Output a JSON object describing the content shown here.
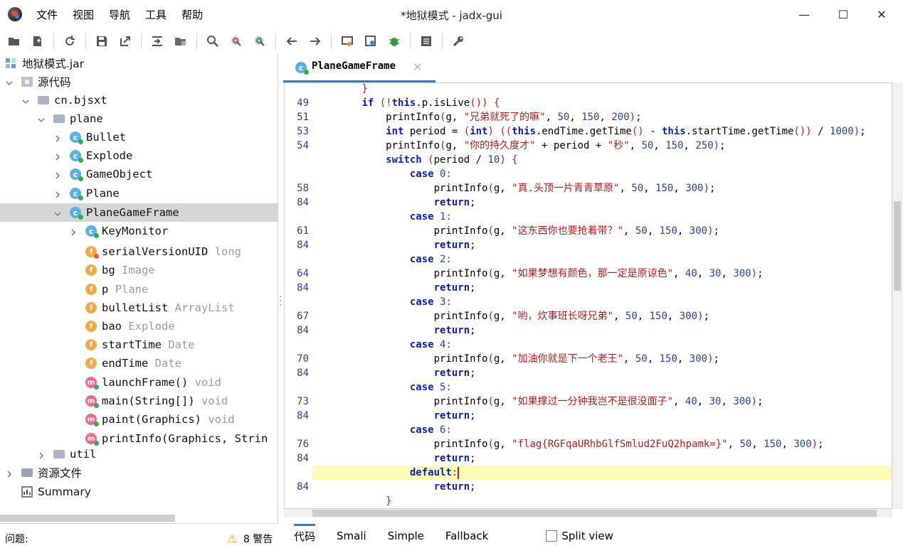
{
  "window": {
    "title": "*地狱模式 - jadx-gui",
    "minimize": "—",
    "maximize": "☐",
    "close": "✕"
  },
  "menu": [
    "文件",
    "视图",
    "导航",
    "工具",
    "帮助"
  ],
  "toolbar": [
    "open-file",
    "add-files",
    "sync",
    "save-all",
    "export",
    "expand",
    "sync-tree",
    "search",
    "find-class",
    "find-usage",
    "back",
    "forward",
    "decompile-settings",
    "deobfuscation",
    "debug",
    "log",
    "preferences"
  ],
  "tree": {
    "root": "地狱模式.jar",
    "sources": "源代码",
    "package": "cn.bjsxt",
    "subpackage": "plane",
    "classes": [
      "Bullet",
      "Explode",
      "GameObject",
      "Plane",
      "PlaneGameFrame"
    ],
    "inner_class": "KeyMonitor",
    "fields": [
      {
        "name": "serialVersionUID",
        "type": "long"
      },
      {
        "name": "bg",
        "type": "Image"
      },
      {
        "name": "p",
        "type": "Plane"
      },
      {
        "name": "bulletList",
        "type": "ArrayList"
      },
      {
        "name": "bao",
        "type": "Explode"
      },
      {
        "name": "startTime",
        "type": "Date"
      },
      {
        "name": "endTime",
        "type": "Date"
      }
    ],
    "methods": [
      {
        "name": "launchFrame()",
        "type": "void"
      },
      {
        "name": "main(String[])",
        "type": "void"
      },
      {
        "name": "paint(Graphics)",
        "type": "void"
      },
      {
        "name": "printInfo(Graphics, Strin",
        "type": ""
      }
    ],
    "util": "util",
    "resources": "资源文件",
    "summary": "Summary"
  },
  "status": {
    "problems_label": "问题:",
    "warnings": "8 警告"
  },
  "tab": {
    "label": "PlaneGameFrame",
    "close": "×"
  },
  "bottom_tabs": {
    "code": "代码",
    "smali": "Smali",
    "simple": "Simple",
    "fallback": "Fallback",
    "split": "Split view"
  },
  "code_lines": [
    {
      "ln": "",
      "text": "        }"
    },
    {
      "ln": "49",
      "text": "        if (!this.p.isLive()) {"
    },
    {
      "ln": "51",
      "text": "            printInfo(g, \"兄弟就死了的嘛\", 50, 150, 200);"
    },
    {
      "ln": "53",
      "text": "            int period = (int) ((this.endTime.getTime() - this.startTime.getTime()) / 1000);"
    },
    {
      "ln": "54",
      "text": "            printInfo(g, \"你的持久度才\" + period + \"秒\", 50, 150, 250);"
    },
    {
      "ln": "",
      "text": "            switch (period / 10) {"
    },
    {
      "ln": "",
      "text": "                case 0:"
    },
    {
      "ln": "58",
      "text": "                    printInfo(g, \"真.头顶一片青青草原\", 50, 150, 300);"
    },
    {
      "ln": "84",
      "text": "                    return;"
    },
    {
      "ln": "",
      "text": "                case 1:"
    },
    {
      "ln": "61",
      "text": "                    printInfo(g, \"这东西你也要抢着带？\", 50, 150, 300);"
    },
    {
      "ln": "84",
      "text": "                    return;"
    },
    {
      "ln": "",
      "text": "                case 2:"
    },
    {
      "ln": "64",
      "text": "                    printInfo(g, \"如果梦想有颜色，那一定是原谅色\", 40, 30, 300);"
    },
    {
      "ln": "84",
      "text": "                    return;"
    },
    {
      "ln": "",
      "text": "                case 3:"
    },
    {
      "ln": "67",
      "text": "                    printInfo(g, \"哟，炊事班长呀兄弟\", 50, 150, 300);"
    },
    {
      "ln": "84",
      "text": "                    return;"
    },
    {
      "ln": "",
      "text": "                case 4:"
    },
    {
      "ln": "70",
      "text": "                    printInfo(g, \"加油你就是下一个老王\", 50, 150, 300);"
    },
    {
      "ln": "84",
      "text": "                    return;"
    },
    {
      "ln": "",
      "text": "                case 5:"
    },
    {
      "ln": "73",
      "text": "                    printInfo(g, \"如果撑过一分钟我岂不是很没面子\", 40, 30, 300);"
    },
    {
      "ln": "84",
      "text": "                    return;"
    },
    {
      "ln": "",
      "text": "                case 6:"
    },
    {
      "ln": "76",
      "text": "                    printInfo(g, \"flag{RGFqaURhbGlfSmlud2FuQ2hpamk=}\", 50, 150, 300);"
    },
    {
      "ln": "84",
      "text": "                    return;"
    },
    {
      "ln": "",
      "text": "                default:"
    },
    {
      "ln": "84",
      "text": "                    return;"
    },
    {
      "ln": "",
      "text": "            }"
    }
  ],
  "highlighted_line": 27,
  "colors": {
    "accent": "#2f7bd6",
    "selection": "#d6d6d6",
    "current_line": "#fcfcb8",
    "keyword": "#0a1fb0",
    "string": "#b71a1a",
    "number": "#2a3f9a"
  }
}
